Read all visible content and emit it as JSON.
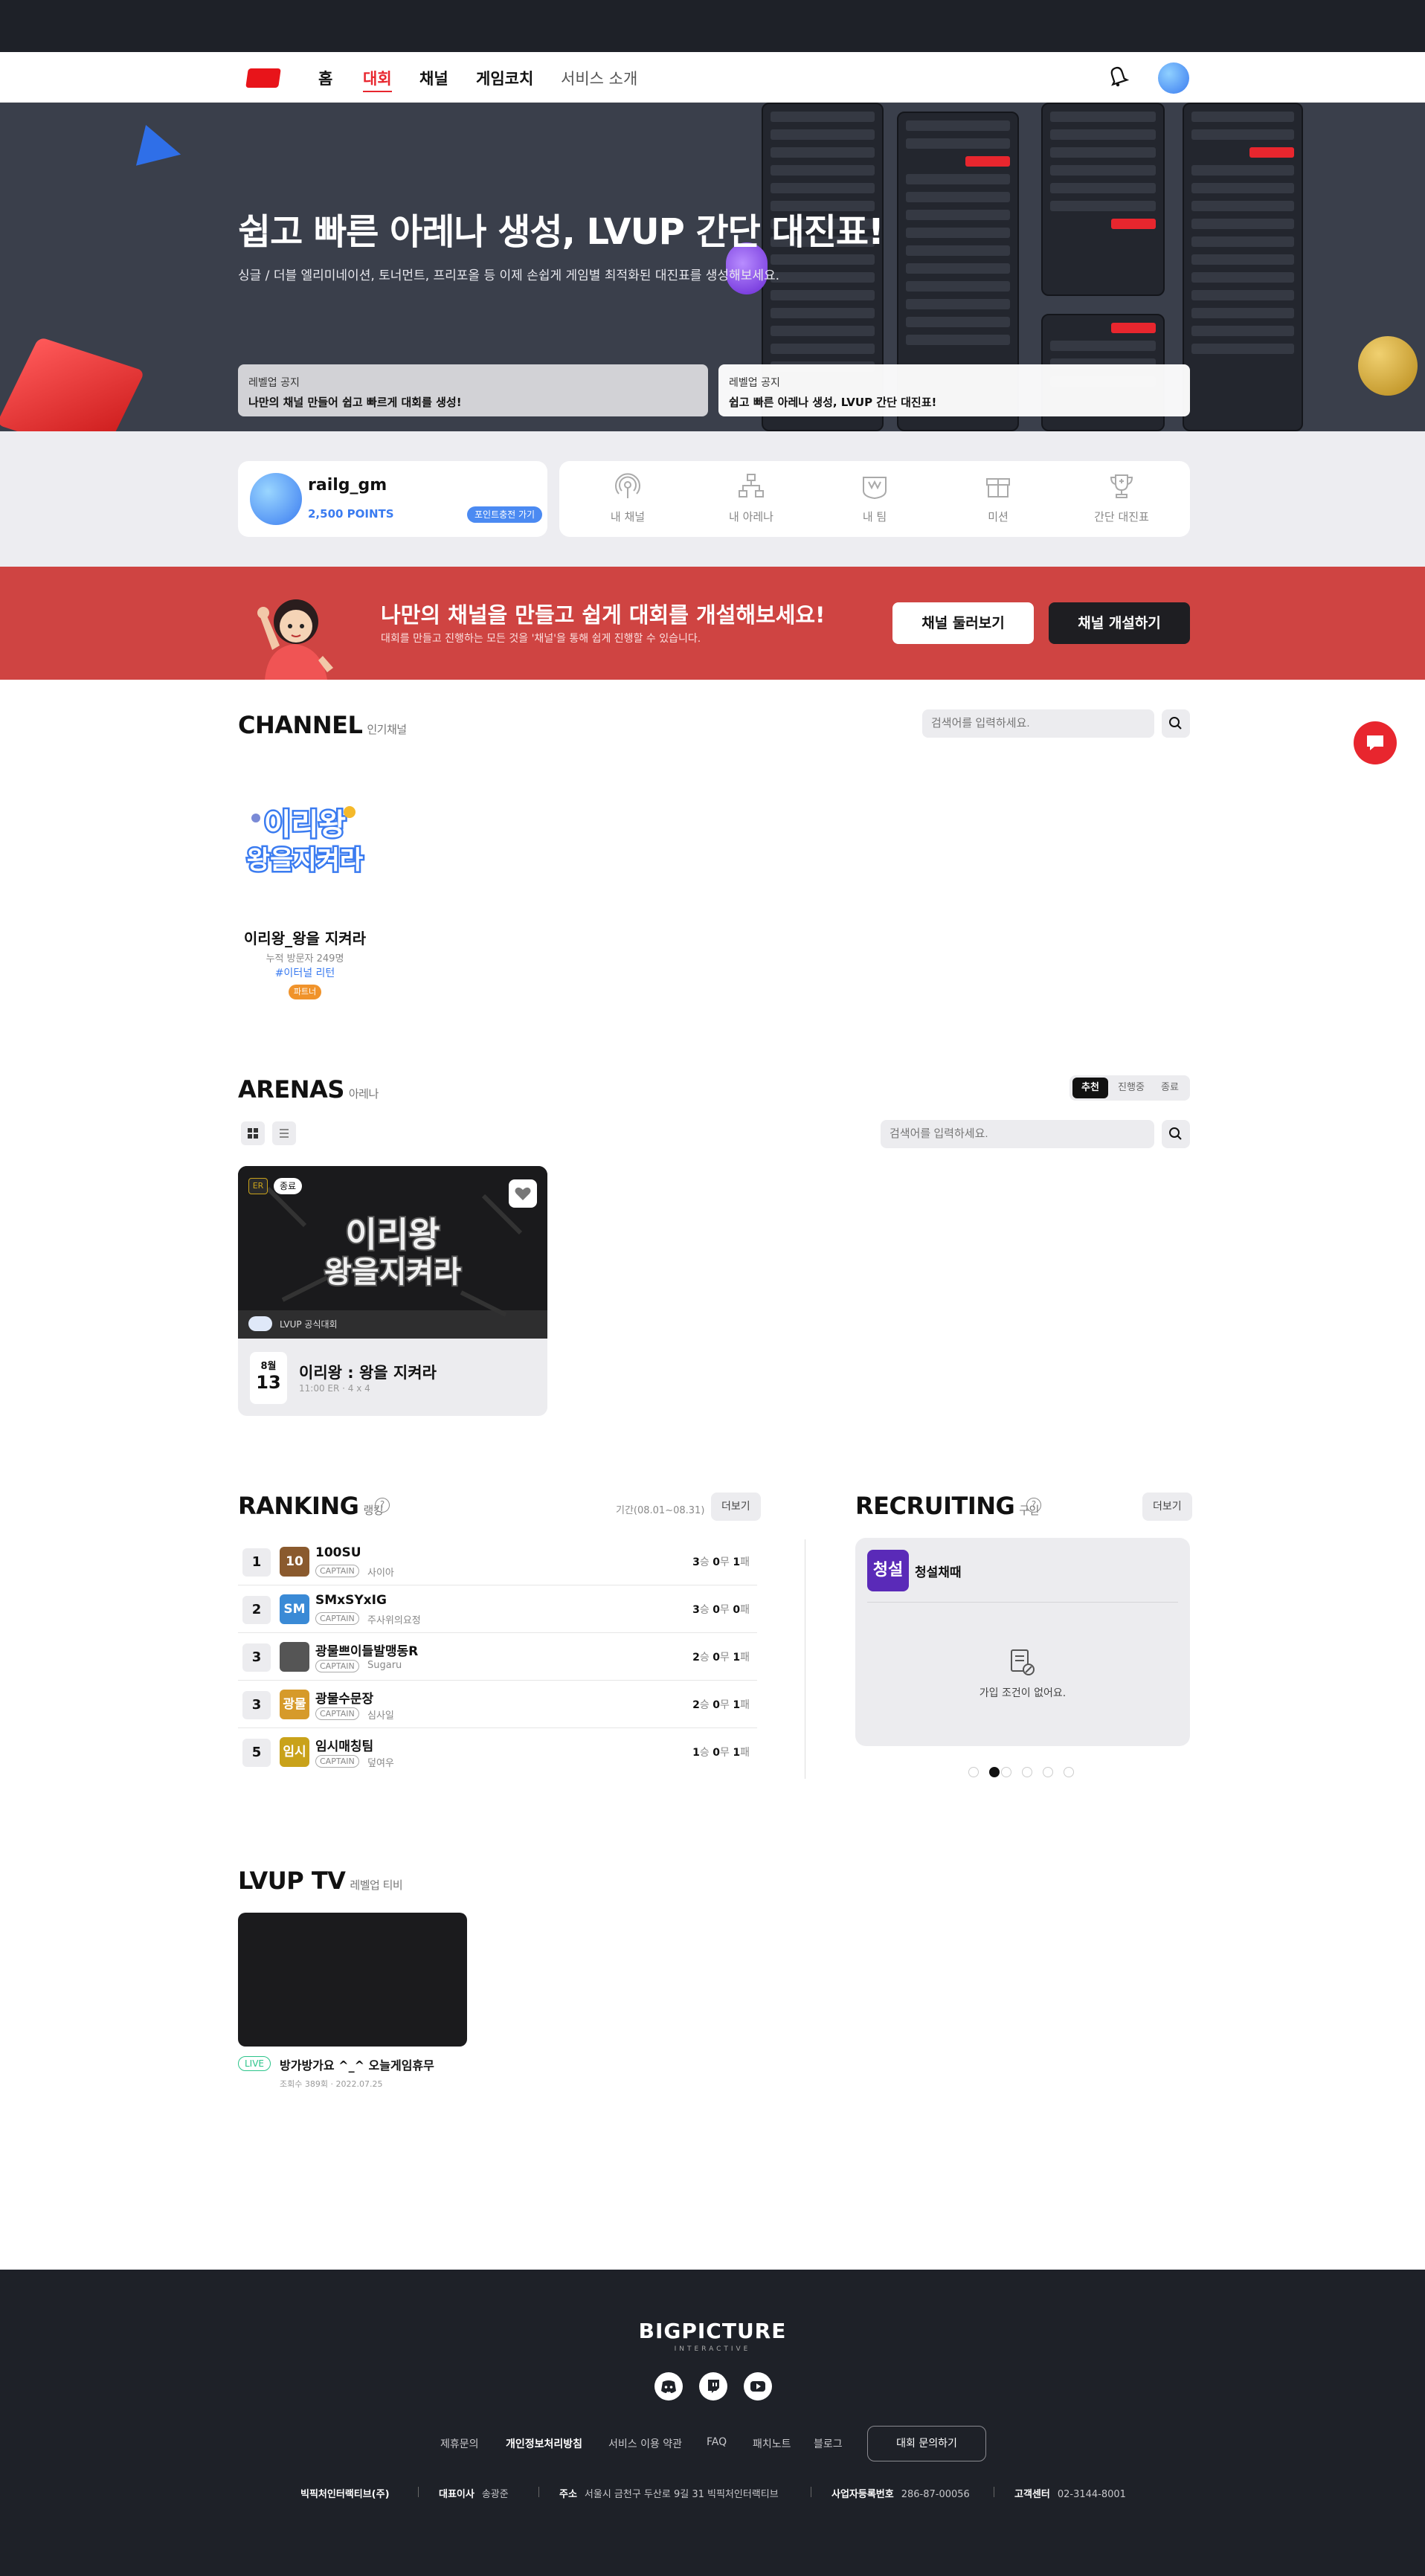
{
  "nav": {
    "items": [
      "홈",
      "대회",
      "채널",
      "게임코치",
      "서비스 소개"
    ],
    "active_index": 1
  },
  "hero": {
    "title": "쉽고 빠른 아레나 생성, LVUP 간단 대진표!",
    "subtitle": "싱글 / 더블 엘리미네이션, 토너먼트, 프리포올 등 이제 손쉽게 게임별 최적화된 대진표를 생성해보세요.",
    "notices": [
      {
        "label": "레벨업 공지",
        "text": "나만의 채널 만들어 쉽고 빠르게 대회를 생성!"
      },
      {
        "label": "레벨업 공지",
        "text": "쉽고 빠른 아레나 생성, LVUP 간단 대진표!"
      }
    ]
  },
  "profile": {
    "username": "railg_gm",
    "points": "2,500 POINTS",
    "charge_label": "포인트충전 가기"
  },
  "quick_menu": [
    {
      "label": "내 채널",
      "icon": "broadcast-icon"
    },
    {
      "label": "내 아레나",
      "icon": "bracket-icon"
    },
    {
      "label": "내 팀",
      "icon": "team-icon"
    },
    {
      "label": "미션",
      "icon": "gift-icon"
    },
    {
      "label": "간단 대진표",
      "icon": "trophy-icon"
    }
  ],
  "banner": {
    "title": "나만의 채널을 만들고 쉽게 대회를 개설해보세요!",
    "subtitle": "대회를 만들고 진행하는 모든 것을 '채널'을 통해 쉽게 진행할 수 있습니다.",
    "browse_label": "채널 둘러보기",
    "create_label": "채널 개설하기"
  },
  "channel": {
    "title": "CHANNEL",
    "subtitle": "인기채널",
    "search_placeholder": "검색어를 입력하세요.",
    "items": [
      {
        "logo_text": "이리왕 왕을지켜라",
        "name": "이리왕_왕을 지켜라",
        "visits": "누적 방문자 249명",
        "tag": "#이터널 리턴",
        "badge": "파트너"
      }
    ]
  },
  "arenas": {
    "title": "ARENAS",
    "subtitle": "아레나",
    "tabs": [
      "추천",
      "진행중",
      "종료"
    ],
    "active_tab": 0,
    "search_placeholder": "검색어를 입력하세요.",
    "items": [
      {
        "status": "종료",
        "game_badge": "ER",
        "official": "LVUP 공식대회",
        "month": "8월",
        "day": "13",
        "name": "이리왕 : 왕을 지켜라",
        "meta": "11:00 ER · 4 x 4",
        "banner_text": "이리왕 왕을지켜라"
      }
    ]
  },
  "ranking": {
    "title": "RANKING",
    "subtitle": "랭킹",
    "period": "기간(08.01~08.31)",
    "more_label": "더보기",
    "rows": [
      {
        "rank": "1",
        "logo": "10",
        "color": "#8a5a2e",
        "name": "100SU",
        "captain": "CAPTAIN",
        "leader": "사이아",
        "win": "3",
        "draw": "0",
        "loss": "1"
      },
      {
        "rank": "2",
        "logo": "SM",
        "color": "#3a8ad6",
        "name": "SMxSYxIG",
        "captain": "CAPTAIN",
        "leader": "주사위의요정",
        "win": "3",
        "draw": "0",
        "loss": "0"
      },
      {
        "rank": "3",
        "logo": "",
        "color": "#555555",
        "name": "광물쁘이들발맹동R",
        "captain": "CAPTAIN",
        "leader": "Sugaru",
        "win": "2",
        "draw": "0",
        "loss": "1"
      },
      {
        "rank": "3",
        "logo": "광물",
        "color": "#d69a2a",
        "name": "광물수문장",
        "captain": "CAPTAIN",
        "leader": "심사일",
        "win": "2",
        "draw": "0",
        "loss": "1"
      },
      {
        "rank": "5",
        "logo": "임시",
        "color": "#c9a21a",
        "name": "임시매칭팀",
        "captain": "CAPTAIN",
        "leader": "덮여우",
        "win": "1",
        "draw": "0",
        "loss": "1"
      }
    ],
    "labels": {
      "win": "승",
      "draw": "무",
      "loss": "패"
    }
  },
  "recruiting": {
    "title": "RECRUITING",
    "subtitle": "구인",
    "more_label": "더보기",
    "team_logo": "청설",
    "team_name": "청설채때",
    "empty_text": "가입 조건이 없어요.",
    "dots": 6,
    "active_dot": 1
  },
  "tv": {
    "title": "LVUP TV",
    "subtitle": "레벨업 티비",
    "items": [
      {
        "live": "LIVE",
        "title": "방가방가요 ^_^ 오늘게임휴무",
        "meta": "조회수 389회 · 2022.07.25"
      }
    ]
  },
  "footer": {
    "logo": "BIGPICTURE",
    "logo_sub": "INTERACTIVE",
    "social": [
      "discord-icon",
      "twitch-icon",
      "youtube-icon"
    ],
    "links": [
      "제휴문의",
      "개인정보처리방침",
      "서비스 이용 약관",
      "FAQ",
      "패치노트",
      "블로그"
    ],
    "bold_link_index": 1,
    "contact_label": "대회 문의하기",
    "company": "빅픽처인터랙티브(주)",
    "ceo_label": "대표이사",
    "ceo": "송광준",
    "address_label": "주소",
    "address": "서울시 금천구 두산로 9길 31 빅픽처인터랙티브",
    "biz_label": "사업자등록번호",
    "biz_no": "286-87-00056",
    "cs_label": "고객센터",
    "cs_no": "02-3144-8001"
  },
  "colors": {
    "accent_red": "#e8262e",
    "banner_red": "#cf4442",
    "points_blue": "#3a7bf0",
    "dark": "#1e2128"
  }
}
